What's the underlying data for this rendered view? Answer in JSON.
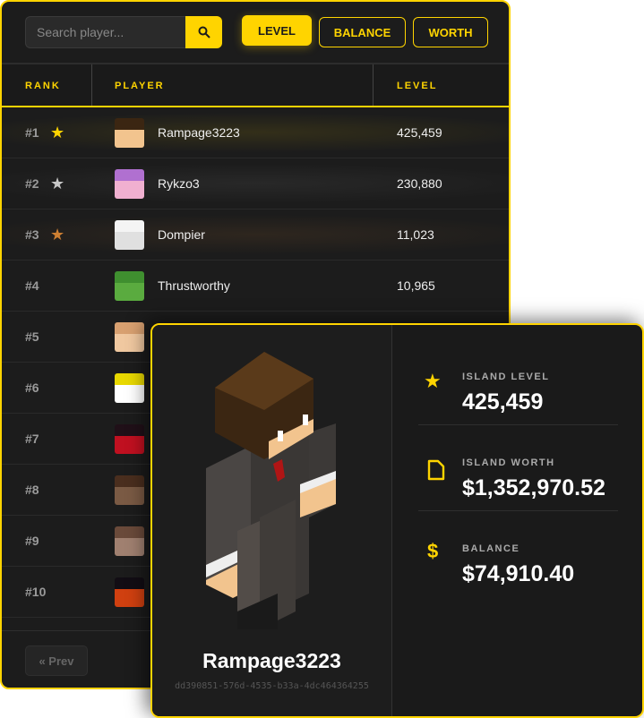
{
  "search": {
    "placeholder": "Search player..."
  },
  "tabs": [
    {
      "label": "LEVEL",
      "active": true
    },
    {
      "label": "BALANCE"
    },
    {
      "label": "WORTH"
    }
  ],
  "columns": {
    "rank": "RANK",
    "player": "PLAYER",
    "value": "LEVEL"
  },
  "rows": [
    {
      "rank": "#1",
      "name": "Rampage3223",
      "value": "425,459",
      "star": "gold"
    },
    {
      "rank": "#2",
      "name": "Rykzo3",
      "value": "230,880",
      "star": "silver"
    },
    {
      "rank": "#3",
      "name": "Dompier",
      "value": "11,023",
      "star": "bronze"
    },
    {
      "rank": "#4",
      "name": "Thrustworthy",
      "value": "10,965"
    },
    {
      "rank": "#5"
    },
    {
      "rank": "#6"
    },
    {
      "rank": "#7"
    },
    {
      "rank": "#8"
    },
    {
      "rank": "#9"
    },
    {
      "rank": "#10"
    }
  ],
  "pagination": {
    "prev": "« Prev"
  },
  "profile": {
    "name": "Rampage3223",
    "uuid": "dd390851-576d-4535-b33a-4dc464364255",
    "stats": [
      {
        "label": "ISLAND LEVEL",
        "value": "425,459",
        "icon": "star-icon"
      },
      {
        "label": "ISLAND WORTH",
        "value": "$1,352,970.52",
        "icon": "document-icon"
      },
      {
        "label": "BALANCE",
        "value": "$74,910.40",
        "icon": "dollar-icon"
      }
    ]
  },
  "colors": {
    "accent": "#ffd400",
    "gold": "#ffd400",
    "silver": "#c8c8c8",
    "bronze": "#cd7f32"
  }
}
